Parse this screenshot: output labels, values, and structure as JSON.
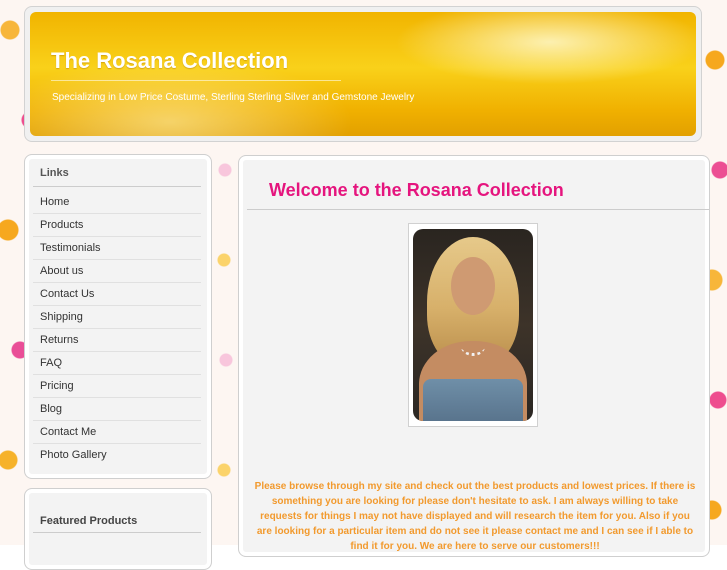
{
  "header": {
    "title": "The Rosana Collection",
    "tagline": "Specializing in Low Price Costume, Sterling Sterling Silver and Gemstone Jewelry"
  },
  "sidebar": {
    "links_heading": "Links",
    "items": [
      {
        "label": "Home"
      },
      {
        "label": "Products"
      },
      {
        "label": "Testimonials"
      },
      {
        "label": "About us"
      },
      {
        "label": "Contact Us"
      },
      {
        "label": "Shipping"
      },
      {
        "label": "Returns"
      },
      {
        "label": "FAQ"
      },
      {
        "label": "Pricing"
      },
      {
        "label": "Blog"
      },
      {
        "label": "Contact Me"
      },
      {
        "label": "Photo Gallery"
      }
    ],
    "featured_heading": "Featured Products"
  },
  "main": {
    "welcome_title": "Welcome to the Rosana Collection",
    "intro_text": "Please browse through my site and check out the best products and lowest prices. If there is something you are looking for please don't hesitate to ask. I am always willing to take requests for things I may not have displayed and will research the item for you. Also if you are looking for a particular item and do not see it please contact me and I can see if I able to find it for you. We are here to serve our customers!!!"
  },
  "colors": {
    "accent_pink": "#e5157e",
    "header_gold": "#f9d11a",
    "intro_orange": "#f29a2e"
  }
}
